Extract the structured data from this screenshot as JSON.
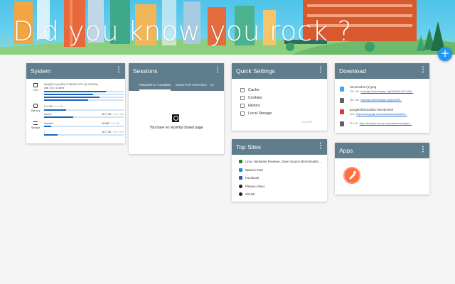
{
  "banner": {
    "title": "Did you know you rock ?",
    "fab": "+"
  },
  "system": {
    "title": "System",
    "menu": "⋮",
    "cpu": {
      "label": "CPU",
      "model_line1": "Intel(R) Core(TM) i7-6500U CPU @ 2.50GHz",
      "model_line2": "x86_64 • 4 cores",
      "bars": [
        0.78,
        0.62,
        0.7,
        0.55
      ]
    },
    "memory": {
      "label": "Memory",
      "used": "2.1 GB",
      "total": " / 7.6 GB",
      "fraction": 0.28
    },
    "storage": {
      "label": "Storage",
      "items": [
        {
          "name": "/home",
          "used": "36.7 GB",
          "total": " / 100.0 GB",
          "fraction": 0.37
        },
        {
          "name": "/bootefi",
          "used": "45 MB",
          "total": " / 511 MB",
          "fraction": 0.09
        },
        {
          "name": "/",
          "used": "16.7 GB",
          "total": " / 100.0 GB",
          "fraction": 0.17
        }
      ]
    }
  },
  "sessions": {
    "title": "Sessions",
    "menu": "⋮",
    "tabs": [
      "RECENTLY CLOSED",
      "DESKTOP-SERVIRO",
      "DI"
    ],
    "empty": "You have no recently closed page"
  },
  "quick_settings": {
    "title": "Quick Settings",
    "menu": "⋮",
    "items": [
      "Cache",
      "Cookies",
      "History",
      "Local Storage"
    ],
    "clear": "CLEAR"
  },
  "top_sites": {
    "title": "Top Sites",
    "menu": "⋮",
    "items": [
      {
        "label": "Linux Hardware Reviews, Open-Source Benchmarks ...",
        "icon": "phoronix-icon",
        "color": "#2e7d32"
      },
      {
        "label": "Epitech Intra",
        "icon": "epitech-icon",
        "color": "#1e88e5"
      },
      {
        "label": "Facebook",
        "icon": "facebook-icon",
        "color": "#3b5998"
      },
      {
        "label": "Pisteyo (Alex)",
        "icon": "github-icon",
        "color": "#222222"
      },
      {
        "label": "GitHub",
        "icon": "github-icon",
        "color": "#222222"
      }
    ]
  },
  "download": {
    "title": "Download",
    "menu": "⋮",
    "items": [
      {
        "name": "Screenshot (1).png",
        "size": "306.1 kB",
        "url": "blob:https://web.telegram.org/f44a0c83-0c57-42b8...",
        "icon": "image-file-icon",
        "color": "#42a5f5"
      },
      {
        "name": "",
        "size": "352.1 kB",
        "url": "blob:https://web.telegram.org/3b1c9e9f...",
        "icon": "file-icon",
        "color": "#616161"
      },
      {
        "name": "google4f18c4d1f5c7ace4b.html",
        "size": "53 B",
        "url": "https://www.google.com/webmasters/verification/...",
        "icon": "html-file-icon",
        "color": "#e53935"
      },
      {
        "name": "",
        "size": "21.4 kB",
        "url": "https://developer.chrome.com/extensions/samples...",
        "icon": "file-icon",
        "color": "#616161"
      }
    ]
  },
  "apps": {
    "title": "Apps",
    "menu": "⋮",
    "items": [
      {
        "name": "Postman",
        "icon": "postman-icon",
        "color": "#ff6e40"
      }
    ]
  }
}
